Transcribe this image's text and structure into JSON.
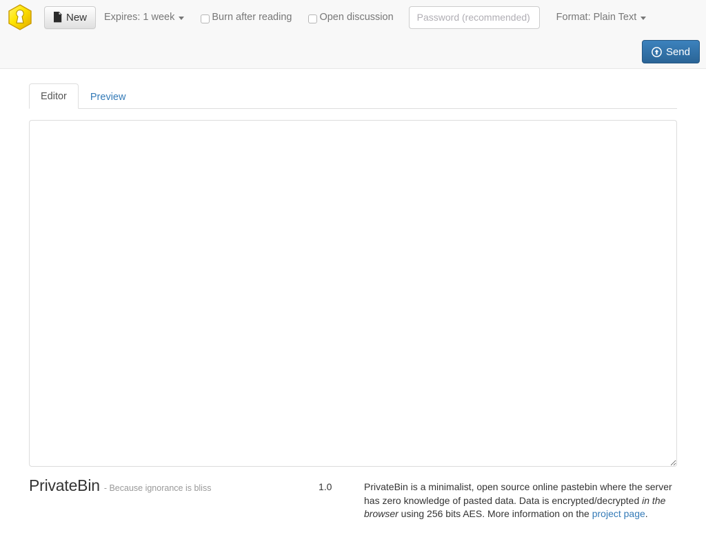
{
  "app": {
    "name": "PrivateBin",
    "logo_icon": "keyhole-hexagon-logo",
    "logo_color": "#f5d000",
    "accent_color": "#337ab7"
  },
  "toolbar": {
    "new_button": {
      "label": "New",
      "icon": "file-icon"
    },
    "expires": {
      "label": "Expires: 1 week",
      "caret_icon": "caret-down-icon"
    },
    "burn_after_reading": {
      "label": "Burn after reading",
      "checked": false
    },
    "open_discussion": {
      "label": "Open discussion",
      "checked": false
    },
    "password": {
      "placeholder": "Password (recommended)",
      "value": ""
    },
    "format": {
      "label": "Format: Plain Text",
      "caret_icon": "caret-down-icon"
    },
    "send_button": {
      "label": "Send",
      "icon": "upload-circle-icon",
      "color": "#2a6496"
    }
  },
  "tabs": [
    {
      "label": "Editor",
      "active": true
    },
    {
      "label": "Preview",
      "active": false
    }
  ],
  "editor": {
    "value": "",
    "placeholder": ""
  },
  "footer": {
    "brand_name": "PrivateBin",
    "slogan": "- Because ignorance is bliss",
    "version": "1.0",
    "description_part1": "PrivateBin is a minimalist, open source online pastebin where the server has zero knowledge of pasted data. Data is encrypted/decrypted ",
    "description_em": "in the browser",
    "description_part2": " using 256 bits AES. More information on the ",
    "project_link": "project page",
    "description_end": "."
  }
}
